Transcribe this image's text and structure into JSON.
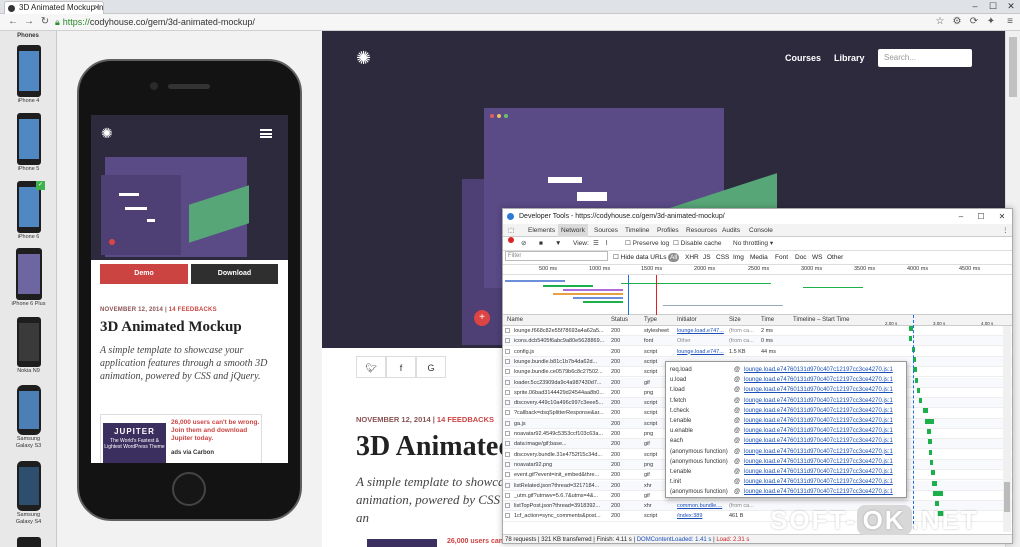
{
  "browser": {
    "tab_title": "3D Animated Mockup in CSS",
    "url_scheme": "https://",
    "url_rest": "codyhouse.co/gem/3d-animated-mockup/"
  },
  "devices": {
    "header": "Phones",
    "items": [
      "iPhone 4",
      "iPhone 5",
      "iPhone 6",
      "iPhone 6 Plus",
      "Nokia N9",
      "Samsung Galaxy S3",
      "Samsung Galaxy S4"
    ]
  },
  "mobile": {
    "demo": "Demo",
    "download": "Download",
    "date": "NOVEMBER 12, 2014",
    "feedbacks": "14 FEEDBACKS",
    "title": "3D Animated Mockup",
    "desc": "A simple template to showcase your application features through a smooth 3D animation, powered by CSS and jQuery.",
    "ad_brand": "JUPITER",
    "ad_img_text": "The World's Fastest & Lightest WordPress Theme",
    "ad_text": "26,000 users can't be wrong. Join them and download Jupiter today.",
    "ad_via": "ads via Carbon"
  },
  "site": {
    "nav": [
      "Courses",
      "Library"
    ],
    "search_placeholder": "Search...",
    "date": "NOVEMBER 12, 2014",
    "feedbacks": "14 FEEDBACKS",
    "title": "3D Animated",
    "desc": "A simple template to showcase animation, powered by CSS an",
    "ad_text": "26,000 users can't be"
  },
  "devtools": {
    "title": "Developer Tools - https://codyhouse.co/gem/3d-animated-mockup/",
    "tabs": [
      "Elements",
      "Network",
      "Sources",
      "Timeline",
      "Profiles",
      "Resources",
      "Audits",
      "Console"
    ],
    "active_tab": "Network",
    "toolbar": {
      "view": "View:",
      "preserve": "Preserve log",
      "cache": "Disable cache",
      "throttle": "No throttling"
    },
    "filter": {
      "placeholder": "Filter",
      "hide": "Hide data URLs",
      "types": [
        "All",
        "XHR",
        "JS",
        "CSS",
        "Img",
        "Media",
        "Font",
        "Doc",
        "WS",
        "Other"
      ]
    },
    "ruler": [
      "500 ms",
      "1000 ms",
      "1500 ms",
      "2000 ms",
      "2500 ms",
      "3000 ms",
      "3500 ms",
      "4000 ms",
      "4500 ms"
    ],
    "columns": [
      "Name",
      "Status",
      "Type",
      "Initiator",
      "Size",
      "Time",
      "Timeline – Start Time"
    ],
    "wf_ticks": [
      "2.00 s",
      "3.00 s",
      "4.00 s"
    ],
    "rows": [
      [
        "lounge.f668c82e55f78693a4a62a5...",
        "200",
        "stylesheet",
        "lounge.load.e747...",
        "(from ca...",
        "2 ms"
      ],
      [
        "icons.dcb5405f6abc9a80e5628869...",
        "200",
        "font",
        "Other",
        "(from ca...",
        "0 ms"
      ],
      [
        "config.js",
        "200",
        "script",
        "lounge.load.e747...",
        "1.5 KB",
        "44 ms"
      ],
      [
        "lounge.bundle.b81c1b7b4da62d...",
        "200",
        "script",
        "",
        "",
        ""
      ],
      [
        "lounge.bundle.ce0579b6c8c27502...",
        "200",
        "script",
        "",
        "",
        ""
      ],
      [
        "loader.5cc23909da9c4a987430d7...",
        "200",
        "gif",
        "",
        "",
        ""
      ],
      [
        "sprite.06bad3144429d24544aa8b0...",
        "200",
        "png",
        "",
        "",
        ""
      ],
      [
        "discovery.449c10a496c997c3eee5...",
        "200",
        "script",
        "",
        "",
        ""
      ],
      [
        "?callback=dsqSplitterResponse&ar...",
        "200",
        "script",
        "",
        "",
        ""
      ],
      [
        "ga.js",
        "200",
        "script",
        "",
        "",
        ""
      ],
      [
        "noavatar92.4549c5353ccf103c63a...",
        "200",
        "png",
        "",
        "",
        ""
      ],
      [
        "data:image/gif;base...",
        "200",
        "gif",
        "",
        "",
        ""
      ],
      [
        "discovery.bundle.31e4752f15c34d...",
        "200",
        "script",
        "",
        "",
        ""
      ],
      [
        "noavatar92.png",
        "200",
        "png",
        "",
        "",
        ""
      ],
      [
        "event.gif?event=init_embed&thre...",
        "200",
        "gif",
        "",
        "",
        ""
      ],
      [
        "listRelated.json?thread=3217184...",
        "200",
        "xhr",
        "",
        "",
        ""
      ],
      [
        "_utm.gif?utmwv=5.6.7&utms=4&...",
        "200",
        "gif",
        "",
        "",
        ""
      ],
      [
        "listTopPost.json?thread=3918392...",
        "200",
        "xhr",
        "common.bundle....",
        "(from ca...",
        ""
      ],
      [
        "1cf_action=sync_comments&post...",
        "200",
        "script",
        "/index:389",
        "461 B",
        ""
      ]
    ],
    "status": {
      "requests": "78 requests",
      "transferred": "321 KB transferred",
      "finish": "Finish: 4.11 s",
      "dcl": "DOMContentLoaded: 1.41 s",
      "load": "Load: 2.31 s"
    },
    "popover": [
      [
        "req.load",
        "lounge.load.e74760131d970c407c12197cc3ce4270.js:1"
      ],
      [
        "u.load",
        "lounge.load.e74760131d970c407c12197cc3ce4270.js:1"
      ],
      [
        "t.load",
        "lounge.load.e74760131d970c407c12197cc3ce4270.js:1"
      ],
      [
        "t.fetch",
        "lounge.load.e74760131d970c407c12197cc3ce4270.js:1"
      ],
      [
        "t.check",
        "lounge.load.e74760131d970c407c12197cc3ce4270.js:1"
      ],
      [
        "t.enable",
        "lounge.load.e74760131d970c407c12197cc3ce4270.js:1"
      ],
      [
        "u.enable",
        "lounge.load.e74760131d970c407c12197cc3ce4270.js:1"
      ],
      [
        "each",
        "lounge.load.e74760131d970c407c12197cc3ce4270.js:1"
      ],
      [
        "(anonymous function)",
        "lounge.load.e74760131d970c407c12197cc3ce4270.js:1"
      ],
      [
        "(anonymous function)",
        "lounge.load.e74760131d970c407c12197cc3ce4270.js:1"
      ],
      [
        "t.enable",
        "lounge.load.e74760131d970c407c12197cc3ce4270.js:1"
      ],
      [
        "t.init",
        "lounge.load.e74760131d970c407c12197cc3ce4270.js:1"
      ],
      [
        "(anonymous function)",
        "lounge.load.e74760131d970c407c12197cc3ce4270.js:1"
      ]
    ]
  },
  "watermark": {
    "left": "SOFT-",
    "ok": "OK",
    "right": ".NET"
  }
}
